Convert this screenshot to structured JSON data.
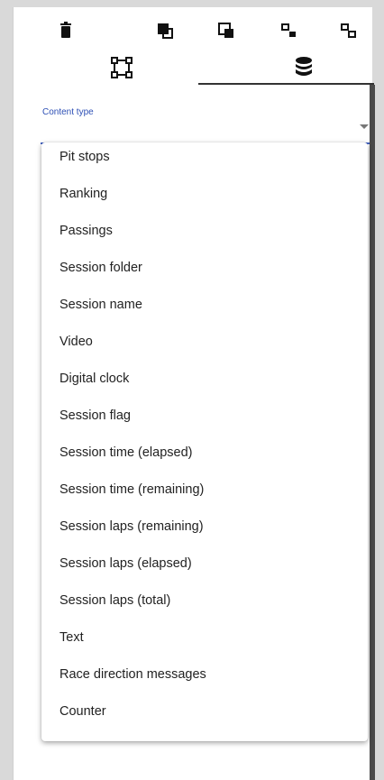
{
  "toolbar": {
    "icons": [
      "delete-icon",
      "bring-to-front-icon",
      "send-to-back-icon",
      "group-icon",
      "ungroup-icon"
    ]
  },
  "tabs": {
    "items": [
      {
        "icon": "layout-selection-icon"
      },
      {
        "icon": "database-icon"
      }
    ],
    "active_index": 1
  },
  "field": {
    "label": "Content type",
    "value": ""
  },
  "menu": {
    "options": [
      "Pit stops",
      "Ranking",
      "Passings",
      "Session folder",
      "Session name",
      "Video",
      "Digital clock",
      "Session flag",
      "Session time (elapsed)",
      "Session time (remaining)",
      "Session laps (remaining)",
      "Session laps (elapsed)",
      "Session laps (total)",
      "Text",
      "Race direction messages",
      "Counter"
    ]
  },
  "colors": {
    "accent": "#3f5fc0",
    "label": "#2d4fb5",
    "text": "#222222",
    "background": "#d9d9d9"
  }
}
